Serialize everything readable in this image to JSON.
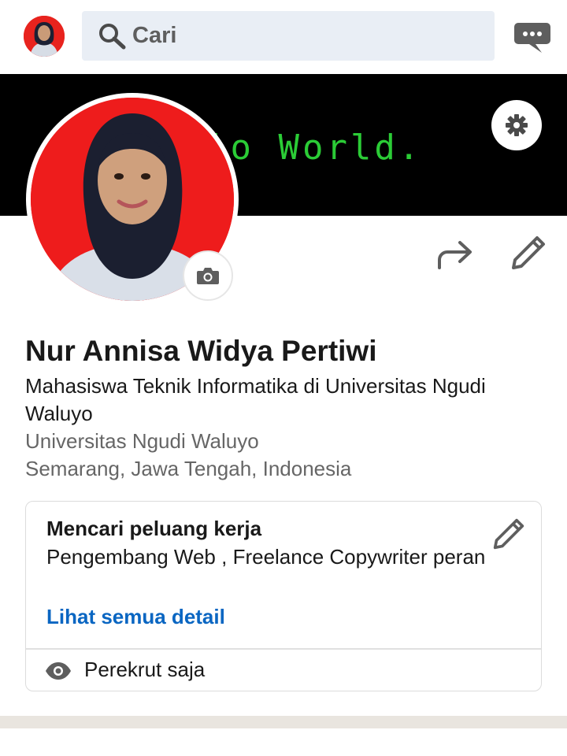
{
  "topbar": {
    "search_placeholder": "Cari",
    "icons": [
      "search-icon",
      "message-icon"
    ]
  },
  "banner": {
    "text": "lo World."
  },
  "profile": {
    "name": "Nur Annisa Widya Pertiwi",
    "headline": "Mahasiswa Teknik Informatika di Universitas Ngudi Waluyo",
    "organization": "Universitas Ngudi Waluyo",
    "location": "Semarang, Jawa Tengah, Indonesia"
  },
  "open_to_work": {
    "title": "Mencari peluang kerja",
    "roles": "Pengembang Web , Freelance Copywriter peran",
    "link": "Lihat semua detail",
    "visibility": "Perekrut saja"
  },
  "colors": {
    "link": "#0a66c2",
    "banner_text": "#2bcc36",
    "photo_background": "#ee1c1c",
    "search_background": "#e9eef5"
  }
}
